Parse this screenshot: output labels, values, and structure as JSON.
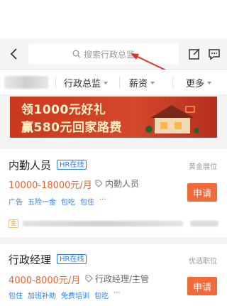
{
  "header": {
    "search_placeholder": "搜索行政总监"
  },
  "filters": [
    {
      "label": "行政总监"
    },
    {
      "label": "薪资"
    },
    {
      "label": "更多"
    }
  ],
  "banner": {
    "line1": "领1000元好礼",
    "line2": "赢580元回家路费"
  },
  "jobs": [
    {
      "title": "内勤人员",
      "badge": "HR在线",
      "tag_right": "黄金展位",
      "salary": "10000-18000元/月",
      "position": "内勤人员",
      "tags": [
        "广告",
        "五险一金",
        "包吃",
        "包住",
        "···"
      ],
      "apply": "申请",
      "footer_badge": "金",
      "accent": "#e8662e"
    },
    {
      "title": "行政经理",
      "badge": "HR在线",
      "tag_right": "优选职位",
      "salary": "4000-8000元/月",
      "position": "行政经理/主管",
      "tags": [
        "包住",
        "加班补助",
        "免费培训",
        "包吃",
        "···"
      ],
      "apply": "申请"
    }
  ],
  "colors": {
    "accent": "#f06a3a",
    "link": "#2b7de9",
    "banner": "#c9391f",
    "annotation_arrow": "#e0302a"
  }
}
